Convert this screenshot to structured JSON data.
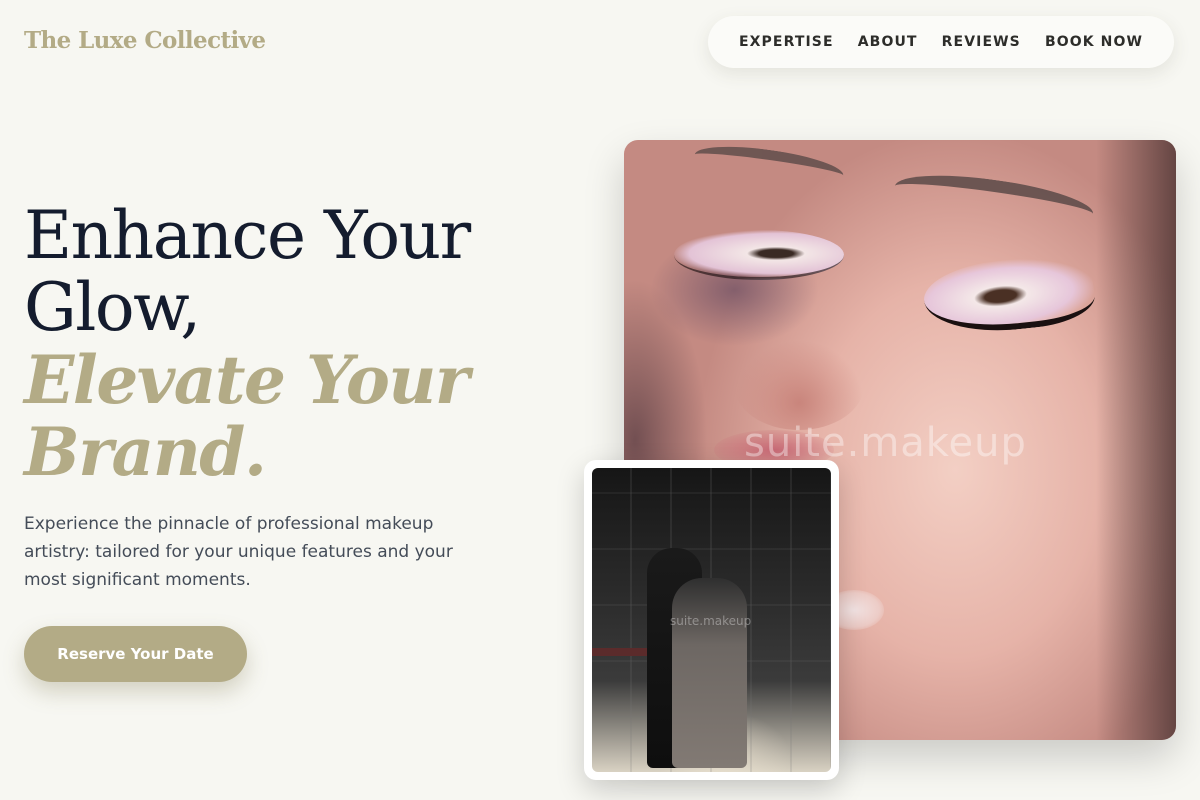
{
  "brand": {
    "logo_text": "The Luxe Collective",
    "accent_color": "#b3ab86",
    "dark_text_color": "#141c2e"
  },
  "nav": {
    "items": [
      {
        "label": "EXPERTISE"
      },
      {
        "label": "ABOUT"
      },
      {
        "label": "REVIEWS"
      },
      {
        "label": "BOOK NOW"
      }
    ]
  },
  "hero": {
    "headline_line1": "Enhance Your",
    "headline_line2": "Glow,",
    "headline_line3": "Elevate Your",
    "headline_line4": "Brand.",
    "description": "Experience the pinnacle of professional makeup artistry: tailored for your unique features and your most significant moments.",
    "cta_label": "Reserve Your Date"
  },
  "images": {
    "main_watermark": "suite.makeup",
    "inset_watermark": "suite.makeup"
  }
}
